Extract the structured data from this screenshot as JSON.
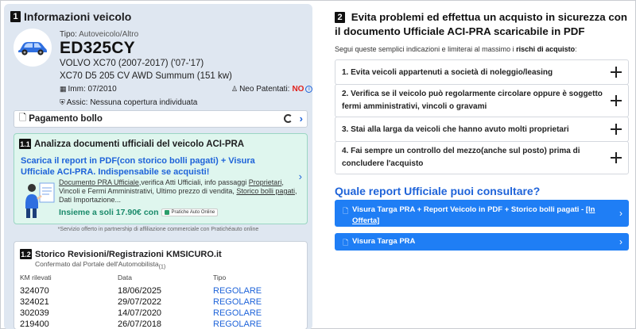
{
  "vehicle": {
    "section_number": "1",
    "section_title": "Informazioni veicolo",
    "type_label": "Tipo:",
    "type_value": "Autoveicolo/Altro",
    "plate": "ED325CY",
    "model_line": "VOLVO XC70 (2007-2017) ('07-'17)",
    "version_line": "XC70 D5 205 CV AWD Summum (151 kw)",
    "imm": "Imm: 07/2010",
    "neo_label": "Neo Patentati:",
    "neo_value": "NO",
    "assic": "Assic: Nessuna copertura individuata",
    "car_color": "#2f6fe0"
  },
  "bollo": {
    "label": "Pagamento bollo"
  },
  "aci": {
    "number": "1.1",
    "title": "Analizza documenti ufficiali del veicolo ACI-PRA",
    "promo": "Scarica il report in PDF(con storico bolli pagati) + Visura Ufficiale ACI-PRA. Indispensabile se acquisti!",
    "desc_u1": "Documento PRA Ufficiale",
    "desc_t1": ",verifica Atti Ufficiali, info passaggi ",
    "desc_u2": "Proprietari",
    "desc_t2": ", Vincoli e Fermi Amministrativi, Ultimo prezzo di vendita, ",
    "desc_u3": "Storico bolli pagati",
    "desc_t3": ", Dati Importazione...",
    "price": "Insieme a soli 17.90€ con",
    "partner": "Pratiche Auto Online",
    "footnote": "*Servizio offerto in partnership di affiliazione commerciale con Pratichéauto online"
  },
  "storico": {
    "number": "1.2",
    "title": "Storico Revisioni/Registrazioni KMSICURO.it",
    "subtitle": "Confermato dal Portale dell'Automobilista",
    "subtitle_sup": "(1)",
    "headers": [
      "KM rilevati",
      "Data",
      "Tipo"
    ],
    "rows": [
      {
        "km": "324070",
        "date": "18/06/2025",
        "type": "REGOLARE"
      },
      {
        "km": "324021",
        "date": "29/07/2022",
        "type": "REGOLARE"
      },
      {
        "km": "302039",
        "date": "14/07/2020",
        "type": "REGOLARE"
      },
      {
        "km": "219400",
        "date": "26/07/2018",
        "type": "REGOLARE"
      }
    ]
  },
  "right": {
    "number": "2",
    "title": "Evita problemi ed effettua un acquisto in sicurezza con il documento Ufficiale ACI-PRA scaricabile in PDF",
    "sub_pre": "Segui queste semplici indicazioni e limiterai al massimo i ",
    "sub_bold": "rischi di acquisto",
    "sub_post": ":",
    "tips": [
      "1. Evita veicoli appartenuti a società di noleggio/leasing",
      "2. Verifica se il veicolo può regolarmente circolare oppure è soggetto fermi amministrativi, vincoli o gravami",
      "3. Stai alla larga da veicoli che hanno avuto molti proprietari",
      "4. Fai sempre un controllo del mezzo(anche sul posto) prima di concludere l'acquisto"
    ],
    "question": "Quale report Ufficiale puoi consultare?",
    "report1_text": "Visura Targa PRA + Report Veicolo in PDF + Storico bolli pagati - ",
    "report1_link": "[In Offerta]",
    "report2_text": "Visura Targa PRA"
  }
}
